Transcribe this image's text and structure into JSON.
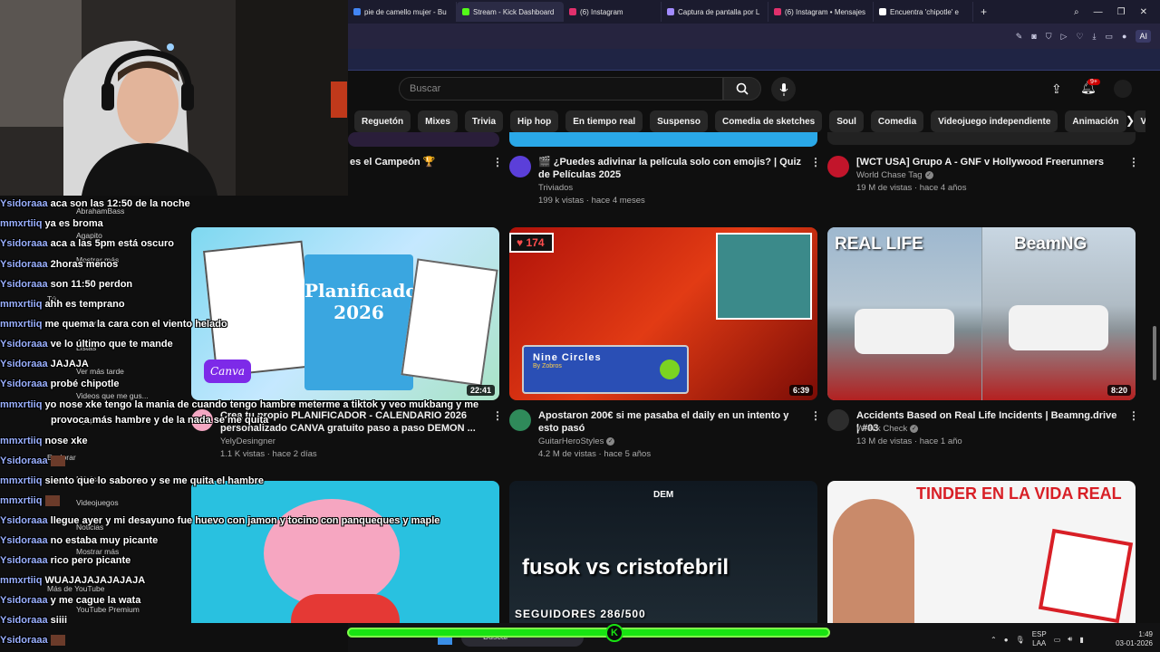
{
  "browser": {
    "tabs": [
      {
        "label": "pie de camello mujer - Bu",
        "color": "#4285f4"
      },
      {
        "label": "Stream - Kick Dashboard",
        "color": "#53fc18"
      },
      {
        "label": "(6) Instagram",
        "color": "#e1306c"
      },
      {
        "label": "Captura de pantalla por L",
        "color": "#a28bff"
      },
      {
        "label": "(6) Instagram • Mensajes",
        "color": "#e1306c"
      },
      {
        "label": "Encuentra 'chipotle' e",
        "color": "#ffffff"
      }
    ],
    "new_tab": "+",
    "ai_label": "AI",
    "window_controls": [
      "⌕",
      "—",
      "❐",
      "✕"
    ]
  },
  "youtube": {
    "search_placeholder": "Buscar",
    "bell_badge": "9+",
    "chips": [
      "Reguetón",
      "Mixes",
      "Trivia",
      "Hip hop",
      "En tiempo real",
      "Suspenso",
      "Comedia de sketches",
      "Soul",
      "Comedia",
      "Videojuego independiente",
      "Animación",
      "Videojuego de"
    ],
    "row1": [
      {
        "title": "es el Campeón 🏆",
        "channel": "",
        "meta": ""
      },
      {
        "title": "🎬 ¿Puedes adivinar la película solo con emojis? | Quiz de Películas 2025",
        "channel": "Triviados",
        "meta": "199 k vistas · hace 4 meses"
      },
      {
        "title": "[WCT USA] Grupo A - GNF v Hollywood Freerunners",
        "channel": "World Chase Tag",
        "meta": "19 M de vistas · hace 4 años"
      }
    ],
    "row2": [
      {
        "title": "Crea tu propio PLANIFICADOR - CALENDARIO 2026 personalizado CANVA gratuito paso a paso DEMON ...",
        "channel": "YelyDesingner",
        "meta": "1.1 K vistas · hace 2 días",
        "duration": "22:41",
        "thumb_text": "Planificador 2026",
        "badge": "Canva"
      },
      {
        "title": "Apostaron 200€ si me pasaba el daily en un intento y esto pasó",
        "channel": "GuitarHeroStyles",
        "meta": "4.2 M de vistas · hace 5 años",
        "duration": "6:39",
        "thumb_text": "Nine Circles",
        "thumb_sub": "By Zobros",
        "likes": "174"
      },
      {
        "title": "Accidents Based on Real Life Incidents | Beamng.drive | #03",
        "channel": "Wreck Check",
        "meta": "13 M de vistas · hace 1 año",
        "duration": "8:20",
        "thumb_left": "REAL LIFE",
        "thumb_right": "BeamNG"
      }
    ],
    "row3": [
      {
        "thumb_text": ""
      },
      {
        "thumb_text": "fusok vs cristofebril",
        "thumb_sub": "SEGUIDORES 286/500",
        "thumb_logo": "DEM"
      },
      {
        "thumb_text": "TINDER EN LA VIDA REAL"
      }
    ]
  },
  "chat": {
    "messages": [
      {
        "user": "Ysidoraaa",
        "text": "aca son las 12:50 de la noche"
      },
      {
        "user": "mmxrtiiq",
        "text": "ya es broma"
      },
      {
        "user": "Ysidoraaa",
        "text": "aca a las 5pm está oscuro"
      },
      {
        "user": "Ysidoraaa",
        "text": "2horas menos"
      },
      {
        "user": "Ysidoraaa",
        "text": "son 11:50 perdon"
      },
      {
        "user": "mmxrtiiq",
        "text": "ahh es temprano"
      },
      {
        "user": "mmxrtiiq",
        "text": "me quema la cara con el viento helado"
      },
      {
        "user": "Ysidoraaa",
        "text": "ve lo último que te mande"
      },
      {
        "user": "Ysidoraaa",
        "text": "JAJAJA"
      },
      {
        "user": "Ysidoraaa",
        "text": "probé chipotle"
      },
      {
        "user": "mmxrtiiq",
        "text": "yo nose xke tengo la mania de cuando tengo hambre meterme a tiktok y veo mukbang y me"
      },
      {
        "user": "",
        "text": "provoca más hambre y de la nada se me quita"
      },
      {
        "user": "mmxrtiiq",
        "text": "nose xke"
      },
      {
        "user": "Ysidoraaa",
        "text": ""
      },
      {
        "user": "mmxrtiiq",
        "text": "siento que lo saboreo y se me quita el hambre"
      },
      {
        "user": "mmxrtiiq",
        "text": ""
      },
      {
        "user": "Ysidoraaa",
        "text": "llegue ayer y mi desayuno fue huevo con jamon y tocino con panqueques y maple"
      },
      {
        "user": "Ysidoraaa",
        "text": "no estaba muy picante"
      },
      {
        "user": "Ysidoraaa",
        "text": "rico pero picante"
      },
      {
        "user": "mmxrtiiq",
        "text": "WUAJAJAJAJAJAJA"
      },
      {
        "user": "Ysidoraaa",
        "text": "y me cague la wata"
      },
      {
        "user": "Ysidoraaa",
        "text": "siiii"
      },
      {
        "user": "Ysidoraaa",
        "text": ""
      }
    ],
    "sidebar_behind": [
      "AbrahamBass",
      "Agapito",
      "Mostrar más",
      "Tú",
      "Historial",
      "Listas",
      "Ver más tarde",
      "Videos que me gus...",
      "Agapito",
      "Explorar",
      "Música",
      "Videojuegos",
      "Noticias",
      "Mostrar más",
      "Más de YouTube",
      "YouTube Premium"
    ]
  },
  "taskbar": {
    "search": "Buscar",
    "lang": "ESP",
    "lang_sub": "LAA",
    "time": "1:49",
    "date": "03-01-2026"
  }
}
